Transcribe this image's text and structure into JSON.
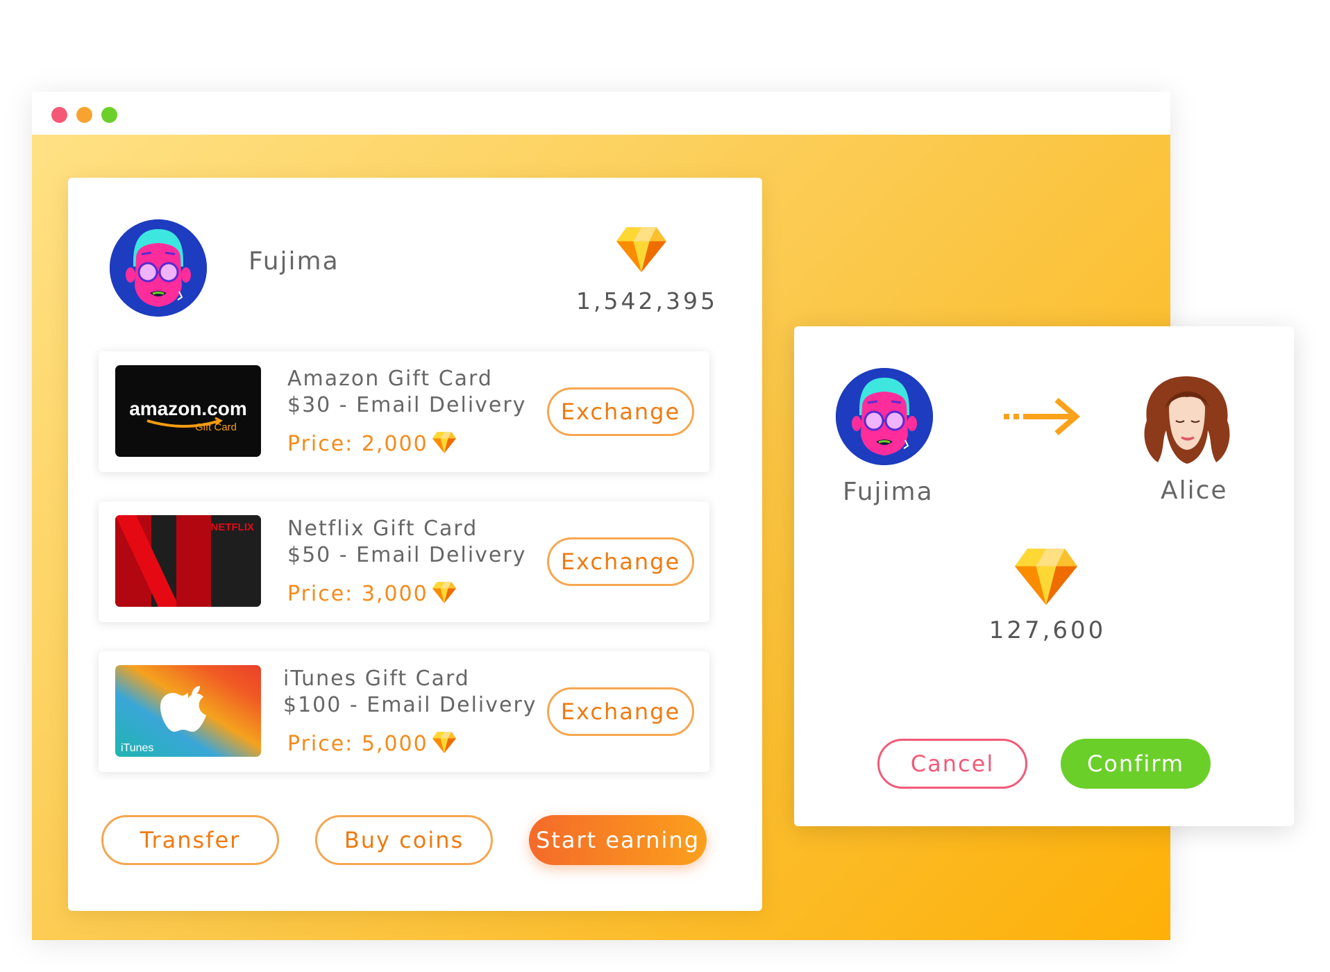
{
  "colors": {
    "accent_orange": "#f07a10",
    "cancel_red": "#f25a78",
    "confirm_green": "#6bcf2a",
    "canvas_gradient": [
      "#ffe184",
      "#fdb008"
    ]
  },
  "window": {
    "controls": [
      "close",
      "minimize",
      "maximize"
    ]
  },
  "wallet": {
    "username": "Fujima",
    "balance": "1,542,395",
    "balance_icon": "diamond-icon"
  },
  "gift_cards": [
    {
      "brand": "amazon",
      "title": "Amazon Gift Card",
      "subtitle": "$30 - Email Delivery",
      "price": "Price: 2,000",
      "button": "Exchange",
      "logo_text": "amazon.com",
      "logo_sub": "Gift Card"
    },
    {
      "brand": "netflix",
      "title": "Netflix Gift Card",
      "subtitle": "$50 - Email Delivery",
      "price": "Price: 3,000",
      "button": "Exchange",
      "logo_text": "NETFLIX"
    },
    {
      "brand": "itunes",
      "title": "iTunes Gift Card",
      "subtitle": "$100 - Email Delivery",
      "price": "Price: 5,000",
      "button": "Exchange",
      "logo_text": "iTunes"
    }
  ],
  "actions": {
    "transfer": "Transfer",
    "buy_coins": "Buy coins",
    "start_earning": "Start earning"
  },
  "transfer_dialog": {
    "from_name": "Fujima",
    "to_name": "Alice",
    "amount": "127,600",
    "cancel": "Cancel",
    "confirm": "Confirm"
  }
}
